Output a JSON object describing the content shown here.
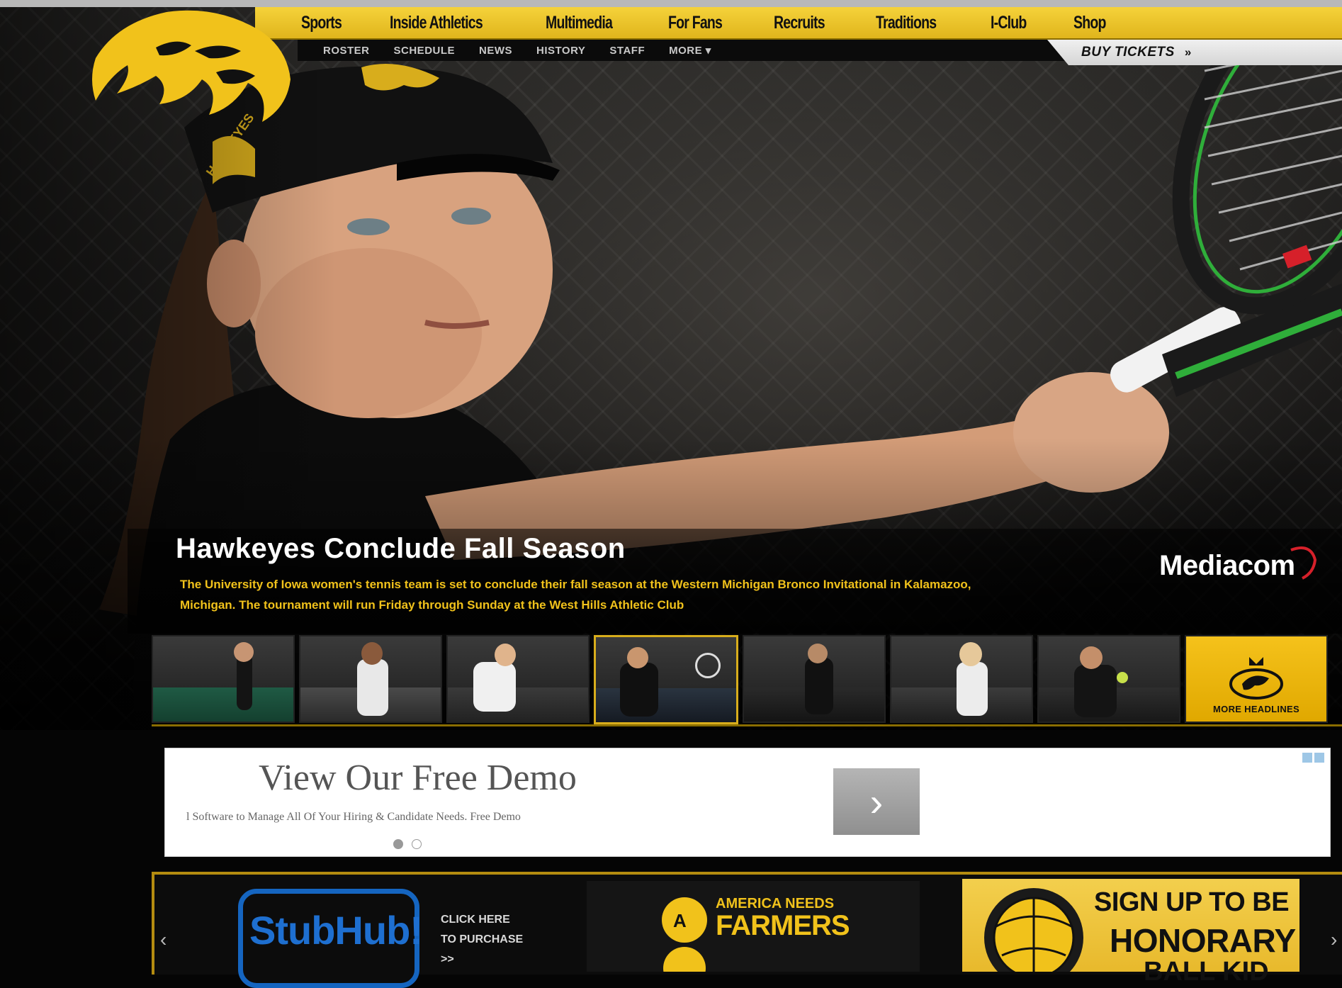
{
  "primary_nav": {
    "items": [
      "Sports",
      "Inside Athletics",
      "Multimedia",
      "For Fans",
      "Recruits",
      "Traditions",
      "I-Club",
      "Shop"
    ]
  },
  "secondary_nav": {
    "items": [
      "ROSTER",
      "SCHEDULE",
      "NEWS",
      "HISTORY",
      "STAFF",
      "MORE ▾"
    ]
  },
  "buy_tickets": {
    "label": "BUY TICKETS",
    "arrow": "»"
  },
  "hero": {
    "headline": "Hawkeyes Conclude Fall Season",
    "body": "The University of Iowa women's tennis team is set to conclude their fall season at the Western Michigan Bronco Invitational in Kalamazoo, Michigan. The tournament will run Friday through Sunday at the West Hills Athletic Club",
    "sponsor": "Mediacom"
  },
  "thumbnails": {
    "more_label": "MORE HEADLINES",
    "active_index": 3
  },
  "ad": {
    "title": "View Our Free Demo",
    "description": "l Software to Manage All Of Your Hiring & Candidate Needs. Free Demo",
    "button_glyph": "›"
  },
  "sponsors": {
    "prev_glyph": "‹",
    "next_glyph": "›",
    "stubhub": {
      "logo": "StubHub!",
      "cta": "CLICK HERE TO PURCHASE >>"
    },
    "farmers": {
      "line1": "AMERICA NEEDS",
      "line2": "FARMERS"
    },
    "ballkid": {
      "line1": "SIGN UP TO BE",
      "line2": "HONORARY",
      "line3": "BALL KID"
    }
  },
  "colors": {
    "gold": "#f1c21b",
    "black": "#050505",
    "stubhub_blue": "#1565c0"
  }
}
